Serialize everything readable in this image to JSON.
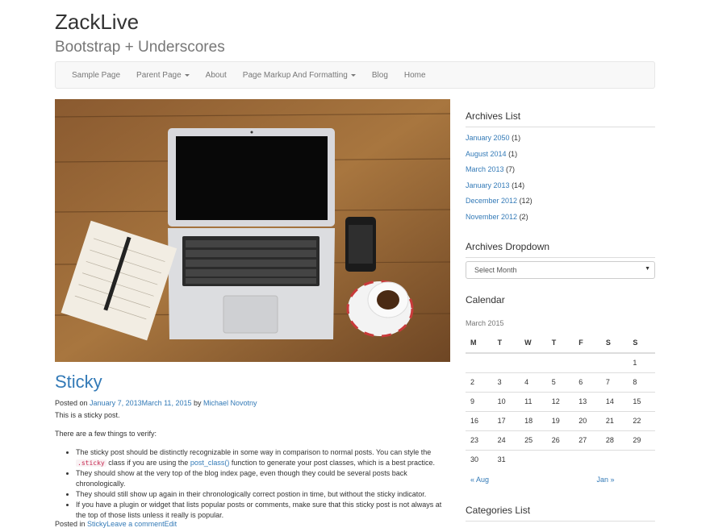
{
  "site": {
    "title": "ZackLive",
    "description": "Bootstrap + Underscores"
  },
  "nav": [
    {
      "label": "Sample Page",
      "dropdown": false
    },
    {
      "label": "Parent Page",
      "dropdown": true
    },
    {
      "label": "About",
      "dropdown": false
    },
    {
      "label": "Page Markup And Formatting",
      "dropdown": true
    },
    {
      "label": "Blog",
      "dropdown": false
    },
    {
      "label": "Home",
      "dropdown": false
    }
  ],
  "post": {
    "title": "Sticky",
    "posted_on": "Posted on",
    "date": "January 7, 2013March 11, 2015",
    "by": "by",
    "author": "Michael Novotny",
    "intro": "This is a sticky post.",
    "lead": "There are a few things to verify:",
    "bullets": {
      "b1_part1": "The sticky post should be distinctly recognizable in some way in comparison to normal posts. You can style the",
      "b1_code": ".sticky",
      "b1_part2": "class if you are using the",
      "b1_link": "post_class()",
      "b1_part3": "function to generate your post classes, which is a best practice.",
      "b2": "They should show at the very top of the blog index page, even though they could be several posts back chronologically.",
      "b3": "They should still show up again in their chronologically correct postion in time, but without the sticky indicator.",
      "b4": "If you have a plugin or widget that lists popular posts or comments, make sure that this sticky post is not always at the top of those lists unless it really is popular."
    },
    "footer_posted_in": "Posted in",
    "footer_category": "Sticky",
    "footer_comment": "Leave a comment",
    "footer_edit": "Edit"
  },
  "sidebar": {
    "archives_title": "Archives List",
    "archives": [
      {
        "label": "January 2050",
        "count": "(1)"
      },
      {
        "label": "August 2014",
        "count": "(1)"
      },
      {
        "label": "March 2013",
        "count": "(7)"
      },
      {
        "label": "January 2013",
        "count": "(14)"
      },
      {
        "label": "December 2012",
        "count": "(12)"
      },
      {
        "label": "November 2012",
        "count": "(2)"
      }
    ],
    "dropdown_title": "Archives Dropdown",
    "dropdown_value": "Select Month",
    "calendar_title": "Calendar",
    "calendar": {
      "caption": "March 2015",
      "headers": [
        "M",
        "T",
        "W",
        "T",
        "F",
        "S",
        "S"
      ],
      "rows": [
        [
          "",
          "",
          "",
          "",
          "",
          "",
          "1"
        ],
        [
          "2",
          "3",
          "4",
          "5",
          "6",
          "7",
          "8"
        ],
        [
          "9",
          "10",
          "11",
          "12",
          "13",
          "14",
          "15"
        ],
        [
          "16",
          "17",
          "18",
          "19",
          "20",
          "21",
          "22"
        ],
        [
          "23",
          "24",
          "25",
          "26",
          "27",
          "28",
          "29"
        ],
        [
          "30",
          "31",
          "",
          "",
          "",
          "",
          ""
        ]
      ],
      "prev": "« Aug",
      "next": "Jan »"
    },
    "categories_title": "Categories List"
  },
  "colors": {
    "link": "#337ab7",
    "navbar_bg": "#f8f8f8",
    "code": "#c7254e"
  }
}
